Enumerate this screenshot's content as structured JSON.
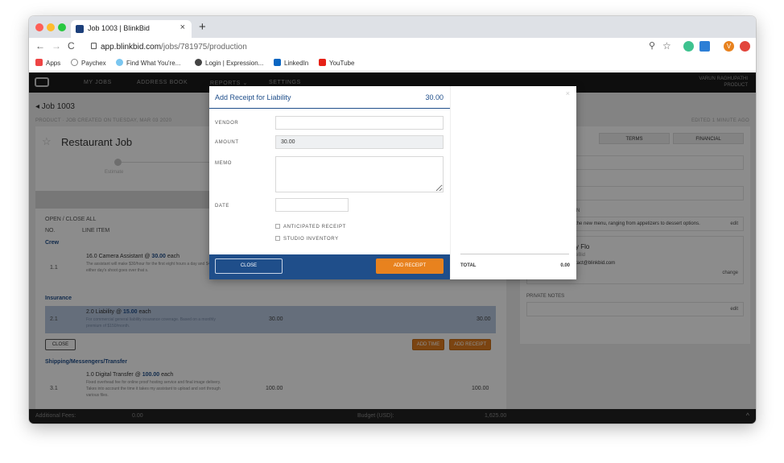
{
  "browser": {
    "tab_title": "Job 1003 | BlinkBid",
    "tab_close": "×",
    "new_tab": "+",
    "back": "←",
    "forward": "→",
    "reload": "C",
    "url_host": "app.blinkbid.com",
    "url_path": "/jobs/781975/production",
    "zoom_icon": "⚲",
    "star_icon": "☆",
    "ext_avatar": "V",
    "bookmarks": [
      "Apps",
      "Paychex",
      "Find What You're...",
      "Login | Expression...",
      "LinkedIn",
      "YouTube"
    ]
  },
  "nav": {
    "links": [
      "MY JOBS",
      "ADDRESS BOOK",
      "REPORTS ⌄",
      "SETTINGS"
    ],
    "user_name": "VARUN RAGHUPATHI",
    "user_role": "PRODUCT"
  },
  "job": {
    "back_title": "◂ Job 1003",
    "subline": "PRODUCT · JOB CREATED ON TUESDAY, MAR 03 2020",
    "edited": "EDITED 1 MINUTE AGO",
    "star": "☆",
    "name": "Restaurant Job",
    "progress_label": "Estimate",
    "open_close": "OPEN / CLOSE ALL",
    "col_no": "NO.",
    "col_item": "LINE ITEM",
    "sections": {
      "crew": "Crew",
      "insurance": "Insurance",
      "shipping": "Shipping/Messengers/Transfer"
    },
    "rows": [
      {
        "no": "1.1",
        "qty_name": "16.0 Camera Assistant @ ",
        "rate": "30.00",
        "unit": " each",
        "desc": "The assistant will make $30/hour for the first eight hours a day and $45/hour if either day's shoot goes over that s.",
        "value1": "",
        "value2": ""
      },
      {
        "no": "2.1",
        "qty_name": "2.0 Liability @ ",
        "rate": "15.00",
        "unit": " each",
        "desc": "For commercial general liability insurance coverage. Based on a monthly premium of $150/month.",
        "value1": "30.00",
        "value2": "30.00"
      },
      {
        "no": "3.1",
        "qty_name": "1.0 Digital Transfer @ ",
        "rate": "100.00",
        "unit": " each",
        "desc": "Fixed overhead fee for online proof hosting service and final image delivery. Takes into account the time it takes my assistant to upload and sort through various files.",
        "value1": "100.00",
        "value2": "100.00"
      }
    ],
    "row_close": "CLOSE",
    "add_time": "ADD TIME",
    "add_receipt": "ADD RECEIPT"
  },
  "side": {
    "tabs": [
      "TERMS",
      "FINANCIAL"
    ],
    "section_label": "N",
    "description": "the new menu, ranging from appetizers to dessert options.",
    "edit": "edit",
    "contact_name": "y Flo",
    "contact_company": "eBid",
    "contact_email": "tact@blinkbid.com",
    "change": "change",
    "private_notes": "PRIVATE NOTES",
    "edit2": "edit"
  },
  "modal": {
    "title": "Add Receipt for Liability",
    "amount": "30.00",
    "vendor_label": "VENDOR",
    "vendor_value": "",
    "amount_label": "AMOUNT",
    "amount_value": "30.00",
    "memo_label": "MEMO",
    "date_label": "DATE",
    "anticipated": "ANTICIPATED RECEIPT",
    "studio_inventory": "STUDIO INVENTORY",
    "close": "CLOSE",
    "add_receipt": "ADD RECEIPT",
    "close_x": "×",
    "total_label": "TOTAL",
    "total_value": "0.00"
  },
  "bottombar": {
    "additional_fees_label": "Additional Fees:",
    "additional_fees_value": "0.00",
    "budget_label": "Budget (USD):",
    "budget_value": "1,625.00",
    "chevron": "^"
  }
}
